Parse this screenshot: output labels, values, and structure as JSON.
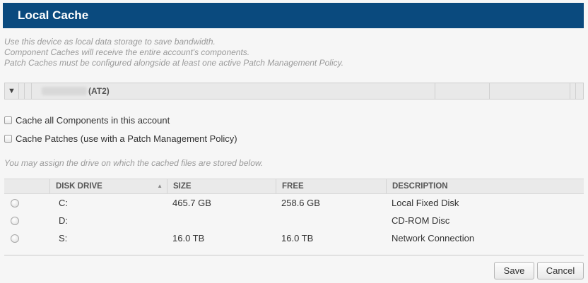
{
  "header": {
    "title": "Local Cache"
  },
  "intro": [
    "Use this device as local data storage to save bandwidth.",
    "Component Caches will receive the entire account's components.",
    "Patch Caches must be configured alongside at least one active Patch Management Policy."
  ],
  "device": {
    "expand_icon": "triangle-down",
    "tag": "(AT2)"
  },
  "options": {
    "cache_components": {
      "label": "Cache all Components in this account",
      "checked": false
    },
    "cache_patches": {
      "label": "Cache Patches (use with a Patch Management Policy)",
      "checked": false
    }
  },
  "assign_text": "You may assign the drive on which the cached files are stored below.",
  "table": {
    "headers": {
      "disk_drive": "DISK DRIVE",
      "size": "SIZE",
      "free": "FREE",
      "description": "DESCRIPTION"
    },
    "sort_icon": "sort-up-icon",
    "rows": [
      {
        "drive": "C:",
        "size": "465.7 GB",
        "free": "258.6 GB",
        "description": "Local Fixed Disk"
      },
      {
        "drive": "D:",
        "size": "",
        "free": "",
        "description": "CD-ROM Disc"
      },
      {
        "drive": "S:",
        "size": "16.0 TB",
        "free": "16.0 TB",
        "description": "Network Connection"
      }
    ]
  },
  "buttons": {
    "save": "Save",
    "cancel": "Cancel"
  },
  "colors": {
    "header_bg": "#0a4a7e",
    "header_text": "#ffffff",
    "muted_text": "#9a9a9a"
  }
}
